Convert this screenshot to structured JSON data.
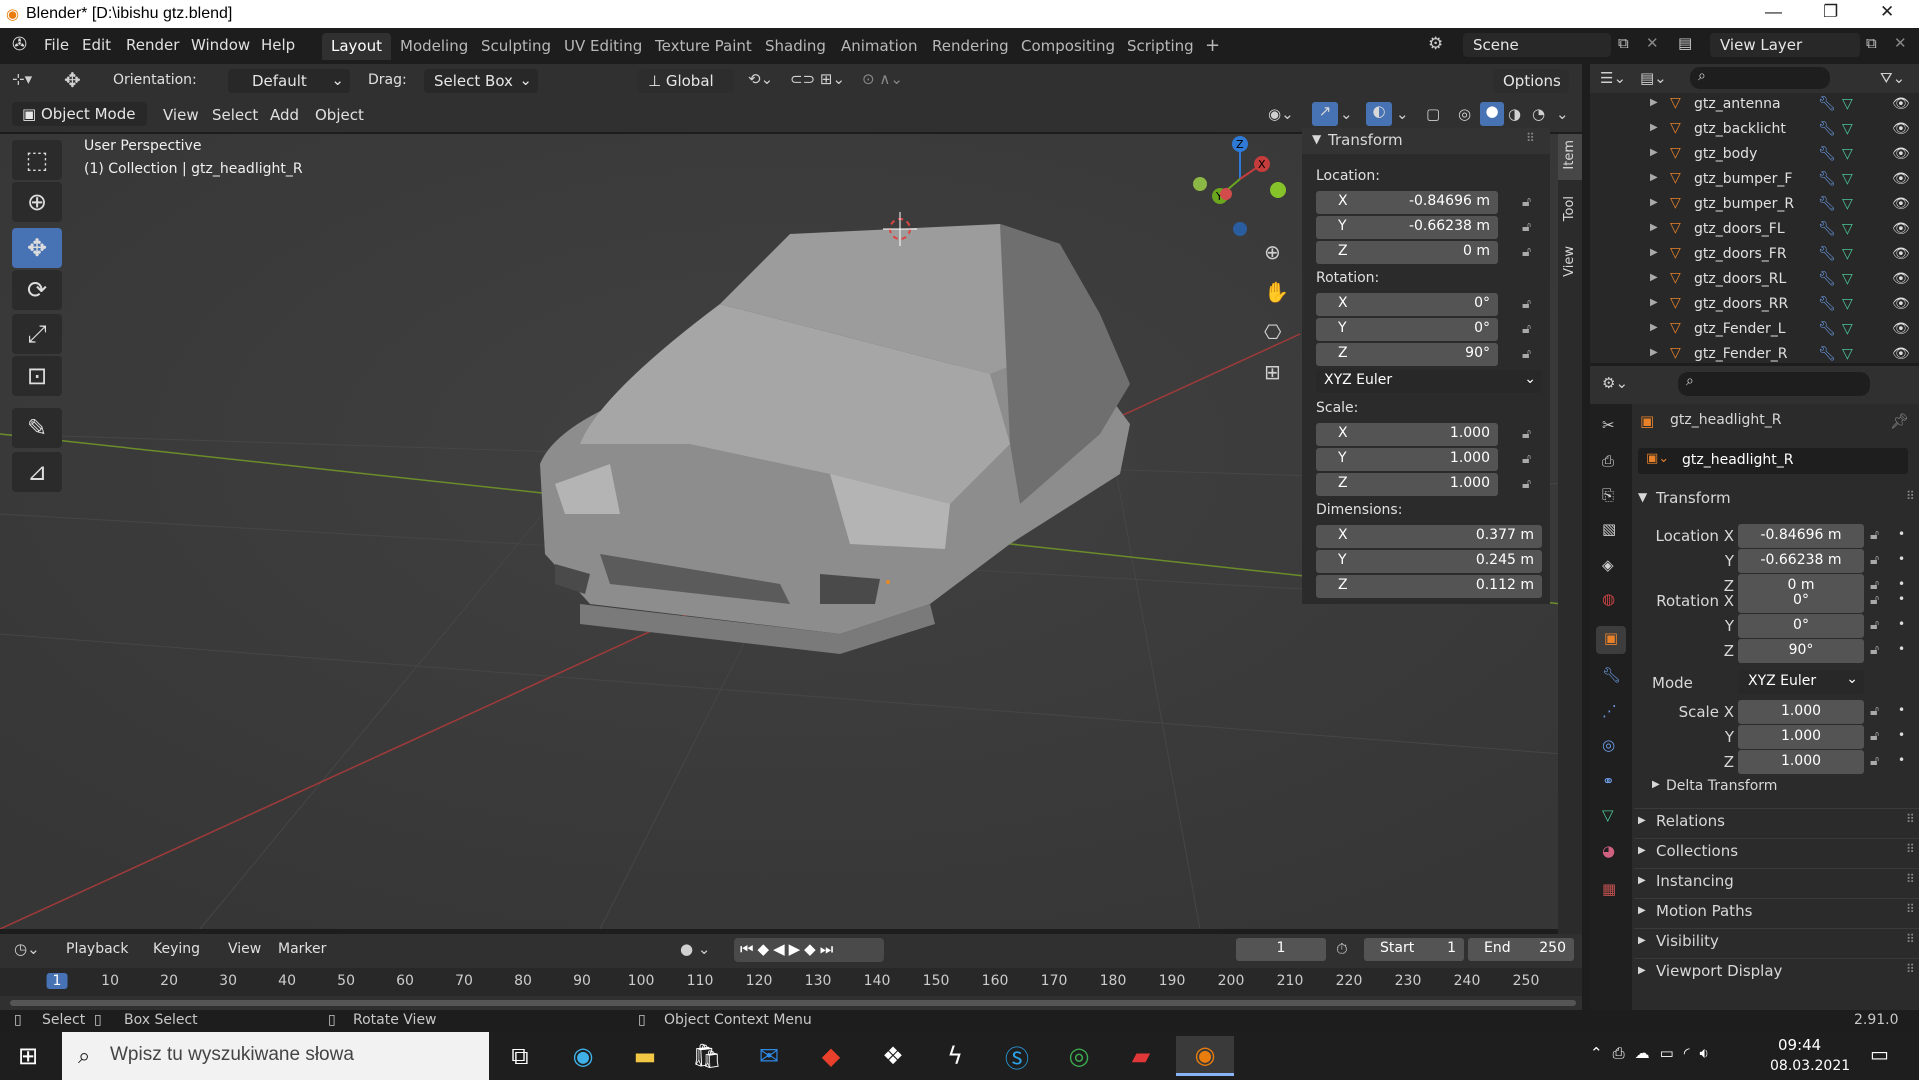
{
  "window": {
    "title": "Blender* [D:\\ibishu gtz.blend]"
  },
  "menu": [
    "File",
    "Edit",
    "Render",
    "Window",
    "Help"
  ],
  "workspaces": [
    "Layout",
    "Modeling",
    "Sculpting",
    "UV Editing",
    "Texture Paint",
    "Shading",
    "Animation",
    "Rendering",
    "Compositing",
    "Scripting"
  ],
  "scene": "Scene",
  "view_layer": "View Layer",
  "tool_header": {
    "orientation_label": "Orientation:",
    "orientation": "Default",
    "drag_label": "Drag:",
    "drag": "Select Box",
    "transform": "Global",
    "options": "Options"
  },
  "viewport_header": {
    "mode": "Object Mode",
    "menus": [
      "View",
      "Select",
      "Add",
      "Object"
    ]
  },
  "viewport": {
    "view_name": "User Perspective",
    "context": "(1) Collection | gtz_headlight_R"
  },
  "npanel": {
    "tabs": [
      "Item",
      "Tool",
      "View"
    ],
    "section": "Transform",
    "location_label": "Location:",
    "location": [
      "-0.84696 m",
      "-0.66238 m",
      "0 m"
    ],
    "rotation_label": "Rotation:",
    "rotation": [
      "0°",
      "0°",
      "90°"
    ],
    "rotation_mode": "XYZ Euler",
    "scale_label": "Scale:",
    "scale": [
      "1.000",
      "1.000",
      "1.000"
    ],
    "dimensions_label": "Dimensions:",
    "dimensions": [
      "0.377 m",
      "0.245 m",
      "0.112 m"
    ],
    "axes": [
      "X",
      "Y",
      "Z"
    ]
  },
  "outliner": [
    "gtz_antenna",
    "gtz_backlicht",
    "gtz_body",
    "gtz_bumper_F",
    "gtz_bumper_R",
    "gtz_doors_FL",
    "gtz_doors_FR",
    "gtz_doors_RL",
    "gtz_doors_RR",
    "gtz_Fender_L",
    "gtz_Fender_R"
  ],
  "properties": {
    "object_name": "gtz_headlight_R",
    "data_name": "gtz_headlight_R",
    "section": "Transform",
    "loc_labels": [
      "Location X",
      "Y",
      "Z"
    ],
    "location": [
      "-0.84696 m",
      "-0.66238 m",
      "0 m"
    ],
    "rot_labels": [
      "Rotation X",
      "Y",
      "Z"
    ],
    "rotation": [
      "0°",
      "0°",
      "90°"
    ],
    "mode_label": "Mode",
    "mode": "XYZ Euler",
    "scale_labels": [
      "Scale X",
      "Y",
      "Z"
    ],
    "scale": [
      "1.000",
      "1.000",
      "1.000"
    ],
    "delta": "Delta Transform",
    "panels": [
      "Relations",
      "Collections",
      "Instancing",
      "Motion Paths",
      "Visibility",
      "Viewport Display"
    ]
  },
  "timeline": {
    "menus": [
      "Playback",
      "Keying",
      "View",
      "Marker"
    ],
    "current_frame": "1",
    "start_label": "Start",
    "start": "1",
    "end_label": "End",
    "end": "250",
    "ticks": [
      "1",
      "10",
      "20",
      "30",
      "40",
      "50",
      "60",
      "70",
      "80",
      "90",
      "100",
      "110",
      "120",
      "130",
      "140",
      "150",
      "160",
      "170",
      "180",
      "190",
      "200",
      "210",
      "220",
      "230",
      "240",
      "250"
    ]
  },
  "status": {
    "select": "Select",
    "box_select": "Box Select",
    "rotate_view": "Rotate View",
    "context_menu": "Object Context Menu",
    "version": "2.91.0"
  },
  "taskbar": {
    "search_placeholder": "Wpisz tu wyszukiwane słowa",
    "time": "09:44",
    "date": "08.03.2021"
  }
}
